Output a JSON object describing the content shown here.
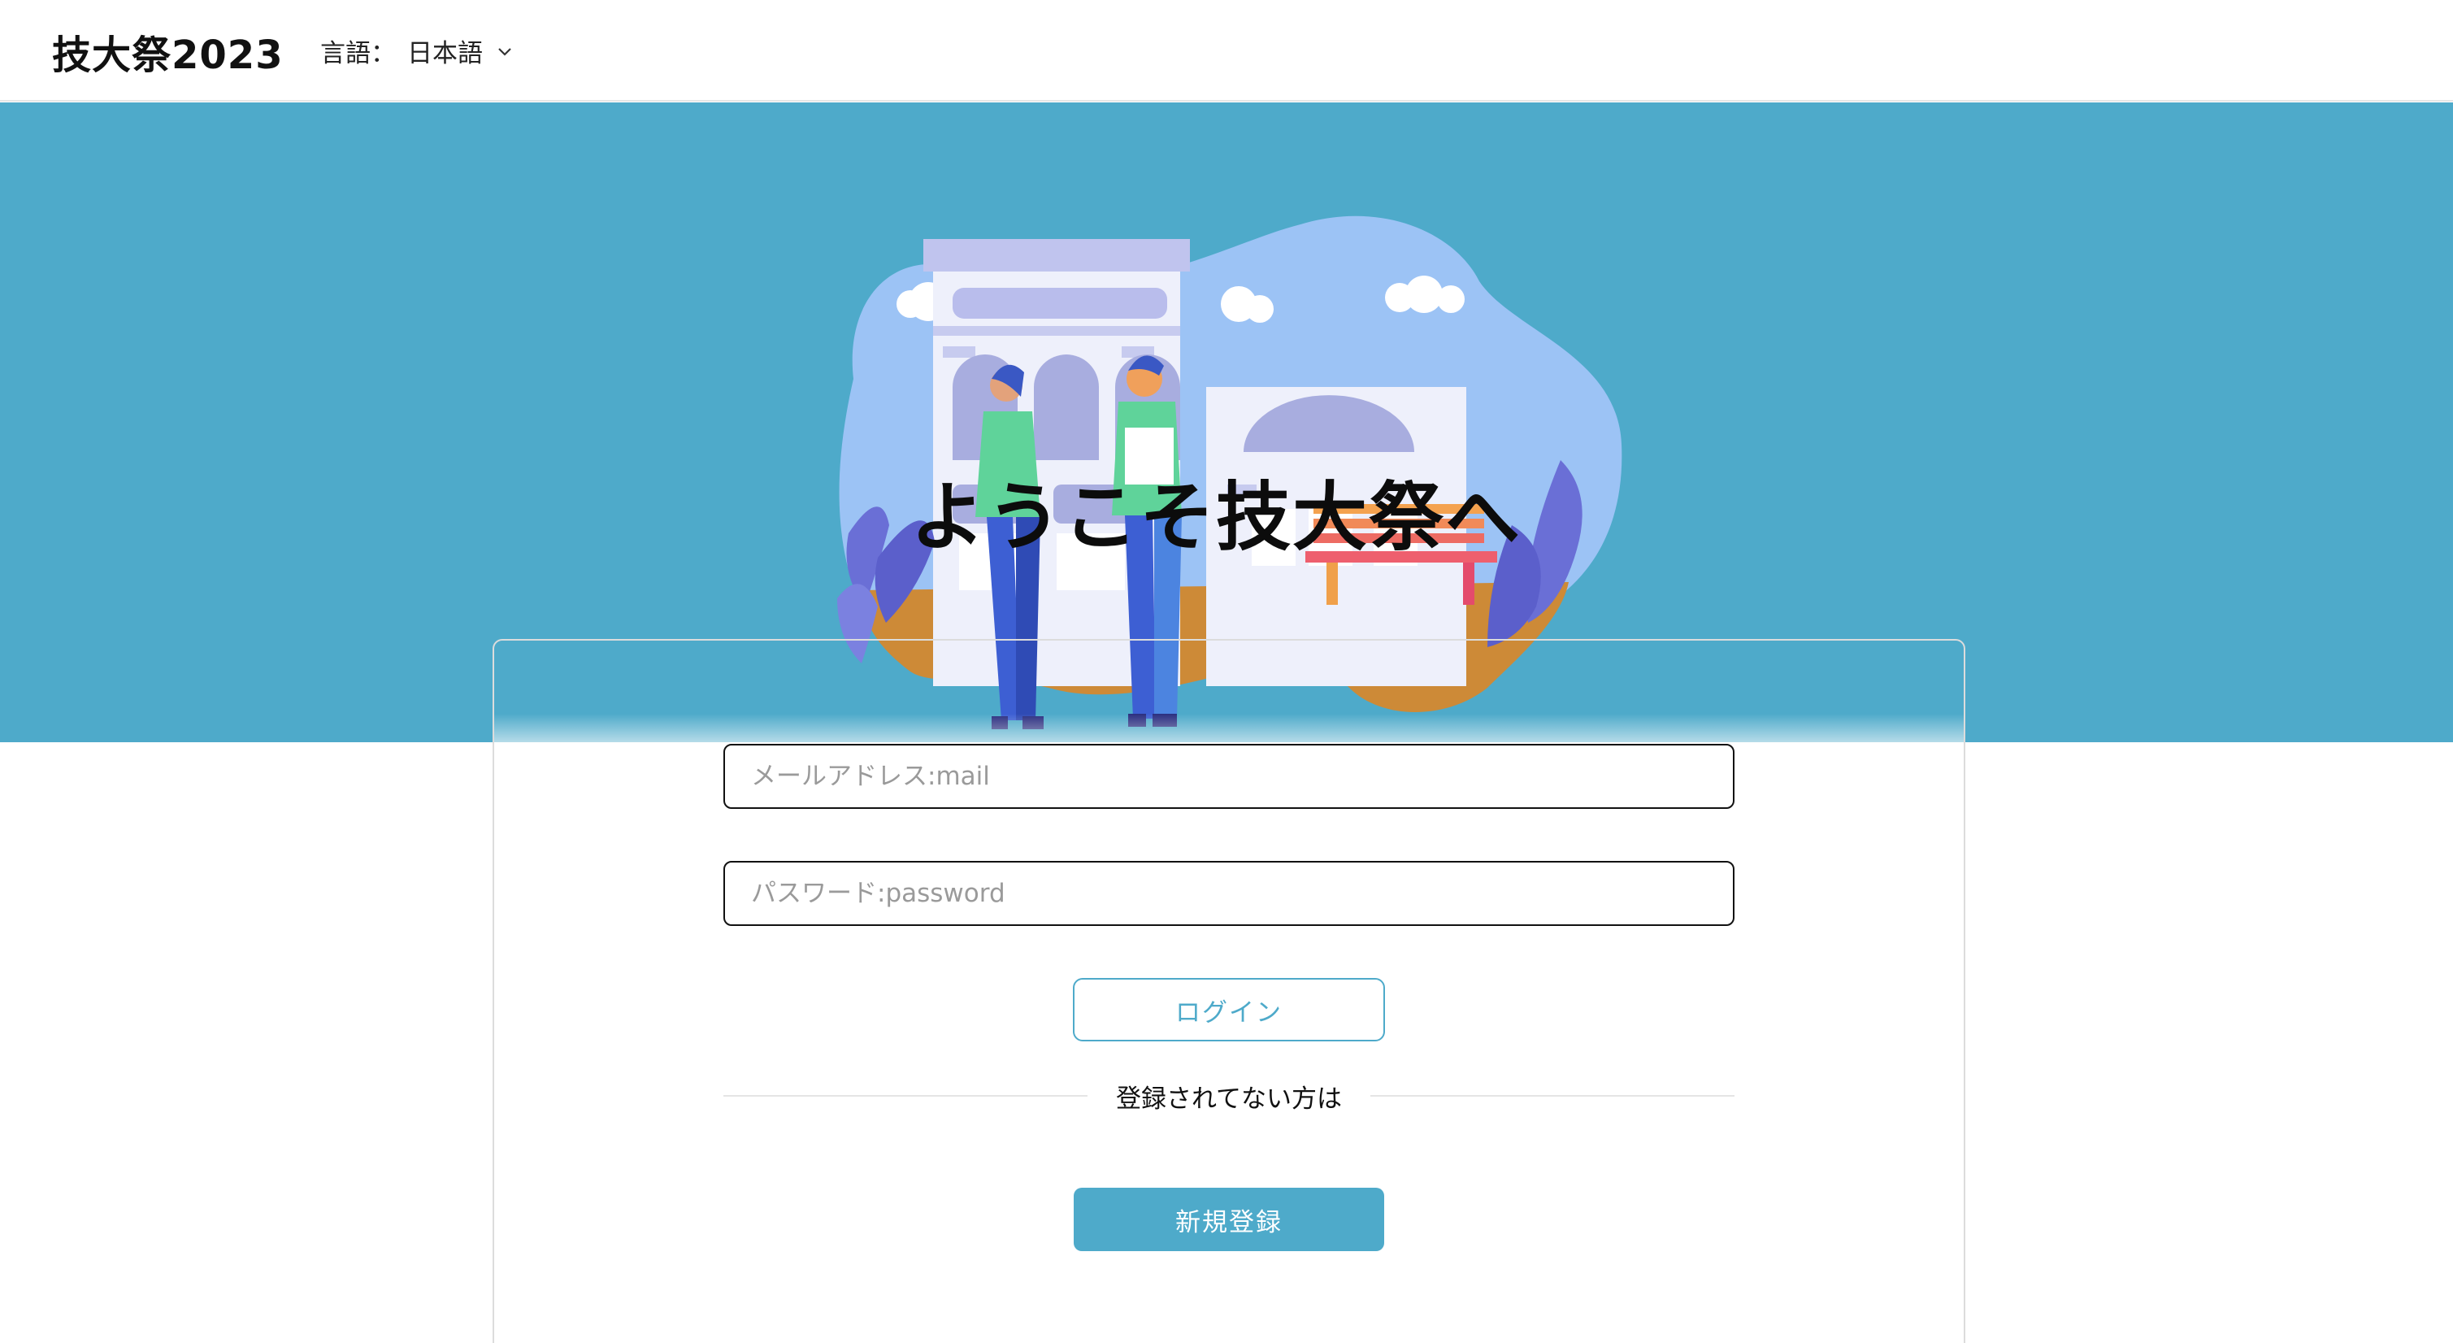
{
  "header": {
    "brand": "技大祭2023",
    "language_label": "言語：",
    "language_value": "日本語",
    "language_icon": "chevron-down-icon"
  },
  "hero": {
    "title": "ようこそ技大祭へ",
    "background_color": "#4eaaca",
    "illustration": "campus-building-with-two-people-and-bench"
  },
  "login_form": {
    "email_placeholder": "メールアドレス:mail",
    "email_value": "",
    "password_placeholder": "パスワード:password",
    "password_value": "",
    "login_button": "ログイン",
    "divider_text": "登録されてない方は",
    "signup_button": "新規登録"
  },
  "colors": {
    "accent": "#4eaaca",
    "text": "#111111",
    "border": "#dcdcdc"
  }
}
